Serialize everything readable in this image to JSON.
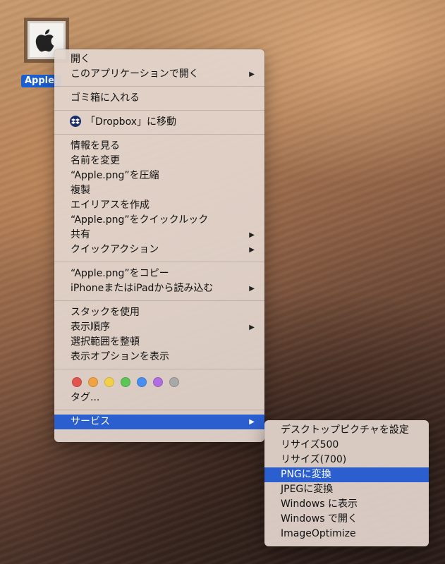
{
  "desktop_icon": {
    "label": "Apple."
  },
  "main_menu": {
    "groups": [
      [
        {
          "label": "開く"
        },
        {
          "label": "このアプリケーションで開く",
          "submenu": true
        }
      ],
      [
        {
          "label": "ゴミ箱に入れる"
        }
      ],
      [
        {
          "label": "「Dropbox」に移動",
          "icon": "dropbox-icon"
        }
      ],
      [
        {
          "label": "情報を見る"
        },
        {
          "label": "名前を変更"
        },
        {
          "label": "“Apple.png”を圧縮"
        },
        {
          "label": "複製"
        },
        {
          "label": "エイリアスを作成"
        },
        {
          "label": "“Apple.png”をクイックルック"
        },
        {
          "label": "共有",
          "submenu": true
        },
        {
          "label": "クイックアクション",
          "submenu": true
        }
      ],
      [
        {
          "label": "“Apple.png”をコピー"
        },
        {
          "label": "iPhoneまたはiPadから読み込む",
          "submenu": true
        }
      ],
      [
        {
          "label": "スタックを使用"
        },
        {
          "label": "表示順序",
          "submenu": true
        },
        {
          "label": "選択範囲を整頓"
        },
        {
          "label": "表示オプションを表示"
        }
      ]
    ],
    "tag_colors": [
      "#e0554e",
      "#f0a343",
      "#f3d04c",
      "#5cc558",
      "#4a8ff0",
      "#b06fe0",
      "#a8a8a8"
    ],
    "tags_label": "タグ...",
    "services_label": "サービス",
    "arrow_glyph": "▶"
  },
  "services_menu": {
    "items": [
      {
        "label": "デスクトップピクチャを設定"
      },
      {
        "label": "リサイズ500"
      },
      {
        "label": "リサイズ(700)"
      },
      {
        "label": "PNGに変換",
        "highlighted": true
      },
      {
        "label": "JPEGに変換"
      },
      {
        "label": "Windows に表示"
      },
      {
        "label": "Windows で開く"
      },
      {
        "label": "ImageOptimize"
      }
    ]
  }
}
